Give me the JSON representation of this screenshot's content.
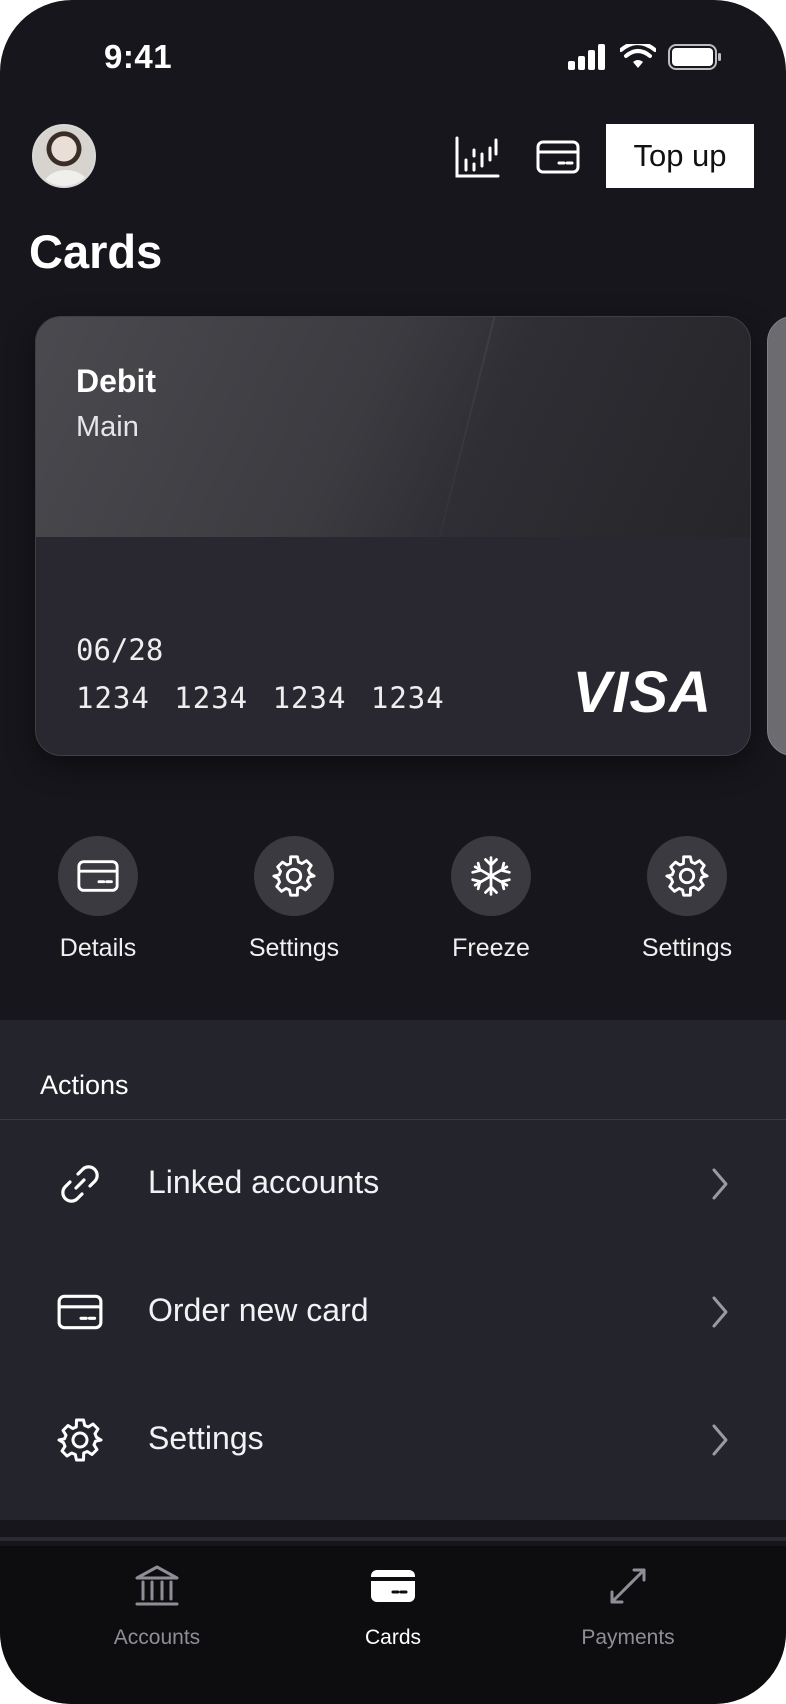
{
  "status_bar": {
    "time": "9:41"
  },
  "header": {
    "top_up_label": "Top up"
  },
  "page": {
    "title": "Cards"
  },
  "card": {
    "type": "Debit",
    "name": "Main",
    "expiry": "06/28",
    "number": "1234 1234 1234 1234",
    "brand": "VISA"
  },
  "quick_actions": [
    {
      "label": "Details",
      "icon": "card-icon"
    },
    {
      "label": "Settings",
      "icon": "gear-icon"
    },
    {
      "label": "Freeze",
      "icon": "snowflake-icon"
    },
    {
      "label": "Settings",
      "icon": "gear-icon"
    }
  ],
  "actions": {
    "heading": "Actions",
    "items": [
      {
        "label": "Linked accounts",
        "icon": "link-icon"
      },
      {
        "label": "Order new card",
        "icon": "card-icon"
      },
      {
        "label": "Settings",
        "icon": "gear-icon"
      }
    ]
  },
  "tabbar": {
    "items": [
      {
        "label": "Accounts",
        "icon": "bank-icon",
        "active": false
      },
      {
        "label": "Cards",
        "icon": "card-icon",
        "active": true
      },
      {
        "label": "Payments",
        "icon": "transfer-arrows-icon",
        "active": false
      }
    ]
  },
  "colors": {
    "background": "#17161c",
    "panel": "#24242d",
    "accent": "#ffffff"
  }
}
